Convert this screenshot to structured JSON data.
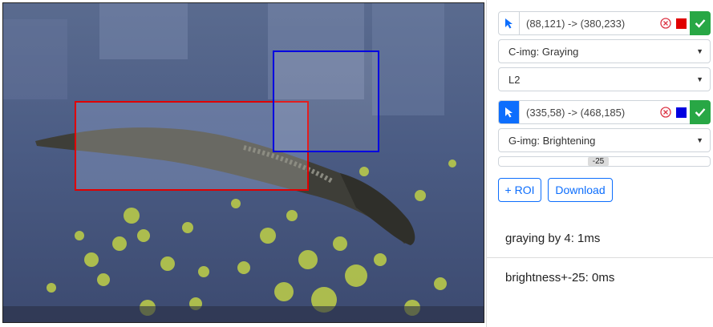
{
  "roi_1": {
    "coords": "(88,121) -> (380,233)",
    "color": "#e00000",
    "filter": "C-img: Graying",
    "metric": "L2"
  },
  "roi_2": {
    "coords": "(335,58) -> (468,185)",
    "color": "#0000e0",
    "filter": "G-img: Brightening",
    "slider_value": "-25",
    "slider_fraction": 0.47
  },
  "actions": {
    "add_roi_label": "+ ROI",
    "download_label": "Download"
  },
  "log": [
    "graying by 4: 1ms",
    "brightness+-25: 0ms"
  ],
  "colors": {
    "accent": "#0d6efd",
    "apply": "#28a745",
    "remove": "#dc3545"
  }
}
